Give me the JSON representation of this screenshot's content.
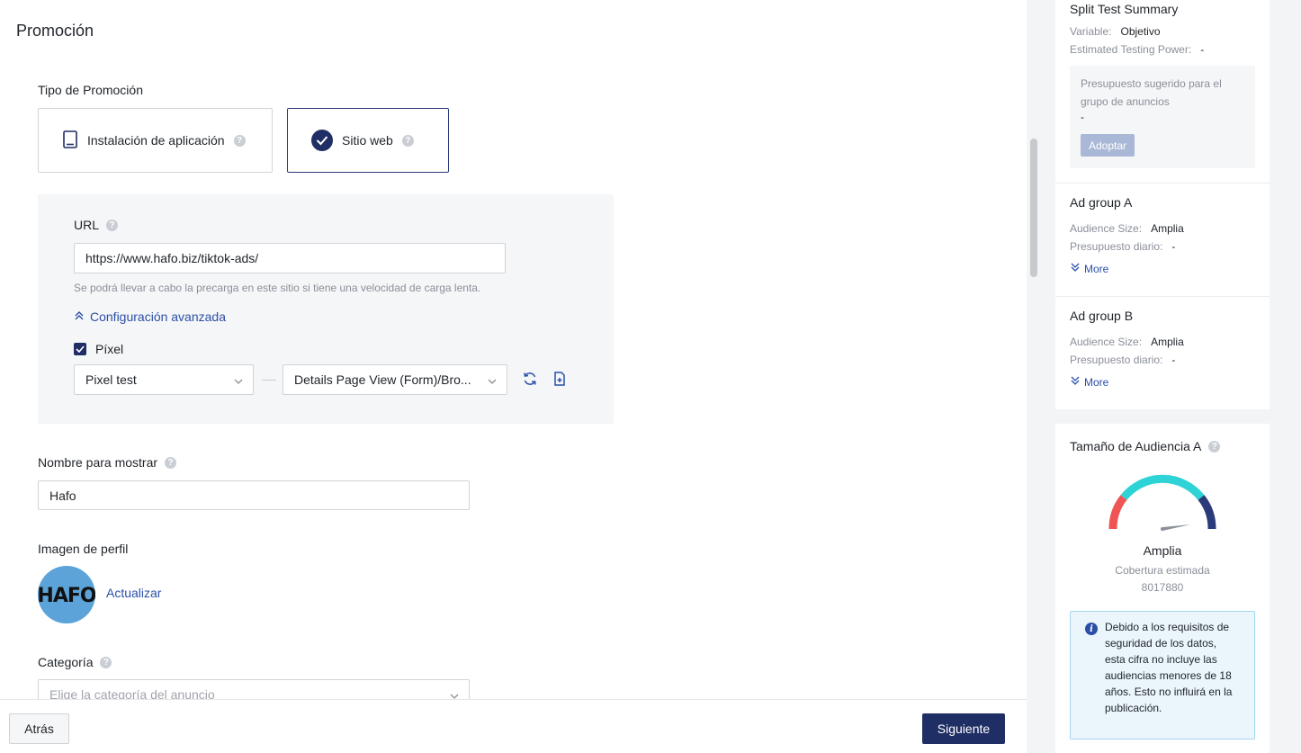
{
  "main": {
    "section_title": "Promoción",
    "promo_type_label": "Tipo de Promoción",
    "promo_options": [
      {
        "label": "Instalación de aplicación"
      },
      {
        "label": "Sitio web"
      }
    ],
    "url_label": "URL",
    "url_value": "https://www.hafo.biz/tiktok-ads/",
    "url_hint": "Se podrá llevar a cabo la precarga en este sitio si tiene una velocidad de carga lenta.",
    "advanced_config": "Configuración avanzada",
    "pixel_label": "Píxel",
    "pixel_select": "Pixel test",
    "event_select": "Details Page View (Form)/Bro...",
    "display_name_label": "Nombre para mostrar",
    "display_name_value": "Hafo",
    "profile_image_label": "Imagen de perfil",
    "avatar_text": "HAFO",
    "update_link": "Actualizar",
    "category_label": "Categoría",
    "category_placeholder": "Elige la categoría del anuncio"
  },
  "footer": {
    "back_label": "Atrás",
    "next_label": "Siguiente"
  },
  "summary": {
    "title": "Split Test Summary",
    "variable_key": "Variable:",
    "variable_value": "Objetivo",
    "power_key": "Estimated Testing Power:",
    "power_value": "-",
    "budget_text": "Presupuesto sugerido para el grupo de anuncios",
    "budget_value": "-",
    "adopt_label": "Adoptar",
    "ad_groups": [
      {
        "title": "Ad group A",
        "audience_key": "Audience Size:",
        "audience_value": "Amplia",
        "budget_key": "Presupuesto diario:",
        "budget_value": "-",
        "more": "More"
      },
      {
        "title": "Ad group B",
        "audience_key": "Audience Size:",
        "audience_value": "Amplia",
        "budget_key": "Presupuesto diario:",
        "budget_value": "-",
        "more": "More"
      }
    ]
  },
  "audience": {
    "title": "Tamaño de Audiencia A",
    "level": "Amplia",
    "coverage_label": "Cobertura estimada",
    "coverage_value": "8017880",
    "gauge_fraction": 0.78,
    "info_text": "Debido a los requisitos de seguridad de los datos, esta cifra no incluye las audiencias menores de 18 años. Esto no influirá en la publicación."
  },
  "colors": {
    "primary": "#1f2e64",
    "link": "#2b4fa8",
    "gauge_red": "#f05454",
    "gauge_teal": "#2ed3d6",
    "gauge_navy": "#2b3a78"
  }
}
